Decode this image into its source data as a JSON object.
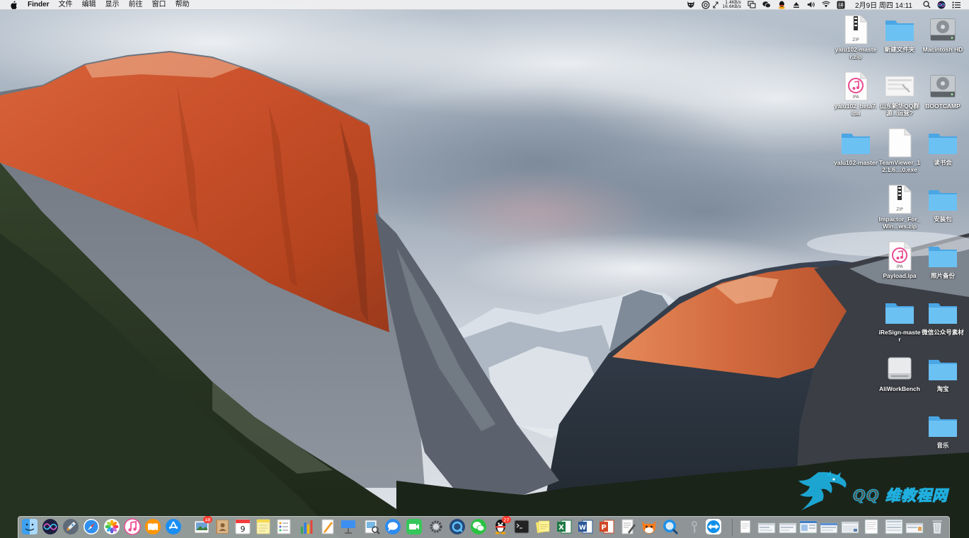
{
  "menubar": {
    "app_name": "Finder",
    "menus": [
      "文件",
      "编辑",
      "显示",
      "前往",
      "窗口",
      "帮助"
    ],
    "net_up": "1.4KB/s",
    "net_down": "16.6KB/s",
    "clock": "2月9日 周四  14:11",
    "status_icons": [
      "cow-icon",
      "scan-icon",
      "resize-icon",
      "display-icon",
      "wechat-icon",
      "qq-icon",
      "eject-icon",
      "volume-icon",
      "wifi-icon",
      "input-method-icon",
      "search-icon",
      "siri-icon",
      "notification-list-icon"
    ],
    "input_method_label": "拼"
  },
  "desktop_icons": [
    {
      "name": "yalu102-master.zip",
      "label": "yalu102-master.zip",
      "type": "zip"
    },
    {
      "name": "新建文件夹",
      "label": "新建文件夹",
      "type": "folder"
    },
    {
      "name": "Macintosh HD",
      "label": "Macintosh HD",
      "type": "hdd"
    },
    {
      "name": "yalu102_beta7.ipa",
      "label": "yalu102_beta7.ipa",
      "type": "ipa"
    },
    {
      "name": "山东新华QQ群",
      "label": "山东新华QQ群源...运营?",
      "type": "screenshot"
    },
    {
      "name": "BOOTCAMP",
      "label": "BOOTCAMP",
      "type": "hdd"
    },
    {
      "name": "yalu102-master",
      "label": "yalu102-master",
      "type": "folder"
    },
    {
      "name": "TeamViewer exe",
      "label": "TeamViewer_12.1.6....0.exe",
      "type": "doc"
    },
    {
      "name": "读书会",
      "label": "读书会",
      "type": "folder"
    },
    {
      "name": "Impactor zip",
      "label": "Impactor_For_Win...ws.zip",
      "type": "zip"
    },
    {
      "name": "安装包",
      "label": "安装包",
      "type": "folder"
    },
    {
      "name": "Payload.ipa",
      "label": "Payload.ipa",
      "type": "ipa"
    },
    {
      "name": "照片备份",
      "label": "照片备份",
      "type": "folder"
    },
    {
      "name": "iReSign-master",
      "label": "iReSign-master",
      "type": "folder"
    },
    {
      "name": "微信公众号素材",
      "label": "微信公众号素材",
      "type": "folder"
    },
    {
      "name": "AliWorkBench",
      "label": "AliWorkBench",
      "type": "drive"
    },
    {
      "name": "淘宝",
      "label": "淘宝",
      "type": "folder"
    },
    {
      "name": "音乐",
      "label": "音乐",
      "type": "folder"
    }
  ],
  "icon_text": {
    "zip": "ZIP",
    "ipa": "IPA"
  },
  "watermark": {
    "text": "QQ 维教程网"
  },
  "dock": {
    "items": [
      {
        "name": "finder",
        "icon": "finder-icon"
      },
      {
        "name": "siri",
        "icon": "siri-icon"
      },
      {
        "name": "launchpad",
        "icon": "rocket-icon"
      },
      {
        "name": "safari",
        "icon": "compass-icon"
      },
      {
        "name": "photos",
        "icon": "photos-icon"
      },
      {
        "name": "itunes",
        "icon": "music-note-icon"
      },
      {
        "name": "ibooks",
        "icon": "book-icon"
      },
      {
        "name": "app-store",
        "icon": "app-store-icon"
      },
      {
        "name": "preview-photos",
        "icon": "image-stack-icon",
        "badge": "48"
      },
      {
        "name": "contacts",
        "icon": "contacts-book-icon"
      },
      {
        "name": "calendar",
        "icon": "calendar-icon",
        "label": "9"
      },
      {
        "name": "notes",
        "icon": "notes-icon"
      },
      {
        "name": "reminders",
        "icon": "reminders-icon"
      },
      {
        "name": "numbers",
        "icon": "bar-chart-icon"
      },
      {
        "name": "pages",
        "icon": "pen-icon"
      },
      {
        "name": "keynote",
        "icon": "podium-icon"
      },
      {
        "name": "preview",
        "icon": "preview-icon"
      },
      {
        "name": "messages",
        "icon": "speech-bubble-icon"
      },
      {
        "name": "facetime",
        "icon": "video-camera-icon"
      },
      {
        "name": "system-preferences",
        "icon": "gear-icon"
      },
      {
        "name": "qq-browser",
        "icon": "q-browser-icon"
      },
      {
        "name": "wechat",
        "icon": "wechat-icon"
      },
      {
        "name": "qq",
        "icon": "penguin-icon",
        "badge": "27"
      },
      {
        "name": "terminal",
        "icon": "terminal-icon"
      },
      {
        "name": "stickies",
        "icon": "sticky-note-icon"
      },
      {
        "name": "excel",
        "icon": "excel-icon",
        "label": "X"
      },
      {
        "name": "word",
        "icon": "word-icon",
        "label": "W"
      },
      {
        "name": "powerpoint",
        "icon": "powerpoint-icon",
        "label": "P"
      },
      {
        "name": "textedit",
        "icon": "document-pen-icon"
      },
      {
        "name": "taobao-aliwangwang",
        "icon": "cow-icon"
      },
      {
        "name": "quicktime-search",
        "icon": "magnifier-icon"
      },
      {
        "name": "keychain",
        "icon": "keys-icon"
      },
      {
        "name": "teamviewer",
        "icon": "teamviewer-icon"
      },
      {
        "name": "documents-folder",
        "icon": "documents-stack-icon"
      },
      {
        "name": "recent-1",
        "icon": "window-thumbnail-icon"
      },
      {
        "name": "recent-2",
        "icon": "window-thumbnail-icon"
      },
      {
        "name": "recent-3",
        "icon": "window-thumbnail-icon"
      },
      {
        "name": "recent-4",
        "icon": "window-thumbnail-icon"
      },
      {
        "name": "recent-5",
        "icon": "window-thumbnail-icon"
      },
      {
        "name": "recent-6",
        "icon": "window-thumbnail-icon"
      },
      {
        "name": "recent-7",
        "icon": "window-thumbnail-icon"
      },
      {
        "name": "recent-8",
        "icon": "window-thumbnail-icon"
      },
      {
        "name": "trash",
        "icon": "trash-icon"
      }
    ]
  },
  "colors": {
    "folder": "#5ab5ee",
    "menubar": "#eeeef0",
    "badge": "#ff3b30",
    "watermark": "#1eb4e6"
  }
}
